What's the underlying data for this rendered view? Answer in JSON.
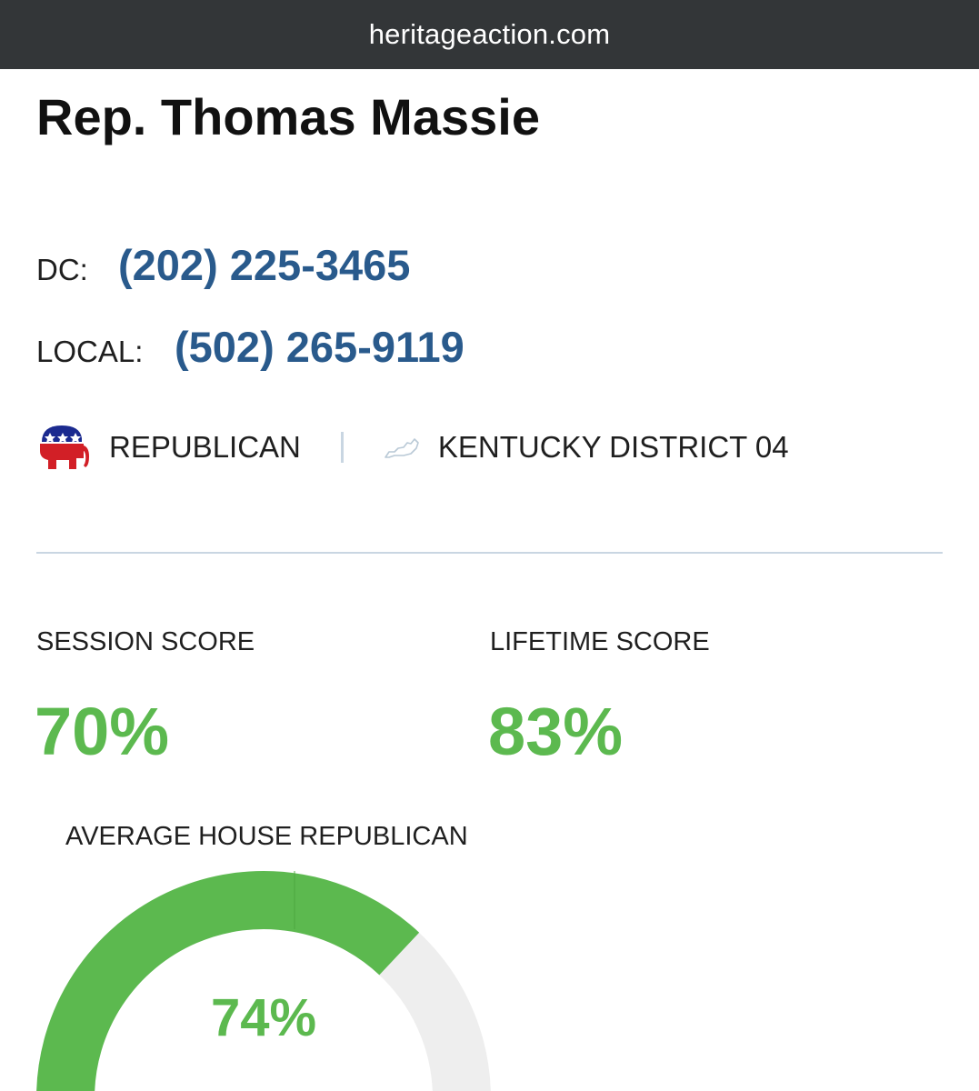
{
  "browser": {
    "url": "heritageaction.com"
  },
  "member": {
    "name": "Rep. Thomas Massie"
  },
  "contact": {
    "dc_label": "DC:",
    "dc_phone": "(202) 225-3465",
    "local_label": "LOCAL:",
    "local_phone": "(502) 265-9119"
  },
  "meta": {
    "party": "REPUBLICAN",
    "party_icon": "republican-elephant-icon",
    "district": "KENTUCKY DISTRICT 04",
    "district_icon": "kentucky-state-outline-icon"
  },
  "scores": {
    "session_label": "SESSION SCORE",
    "session_value": "70%",
    "lifetime_label": "LIFETIME SCORE",
    "lifetime_value": "83%"
  },
  "average": {
    "label": "AVERAGE HOUSE REPUBLICAN",
    "value_text": "74%",
    "value": 74
  },
  "colors": {
    "score_green": "#5cb94f",
    "phone_blue": "#295a8c",
    "gauge_track": "#eeeeee",
    "divider": "#c9d6e2",
    "url_bar": "#333638"
  }
}
